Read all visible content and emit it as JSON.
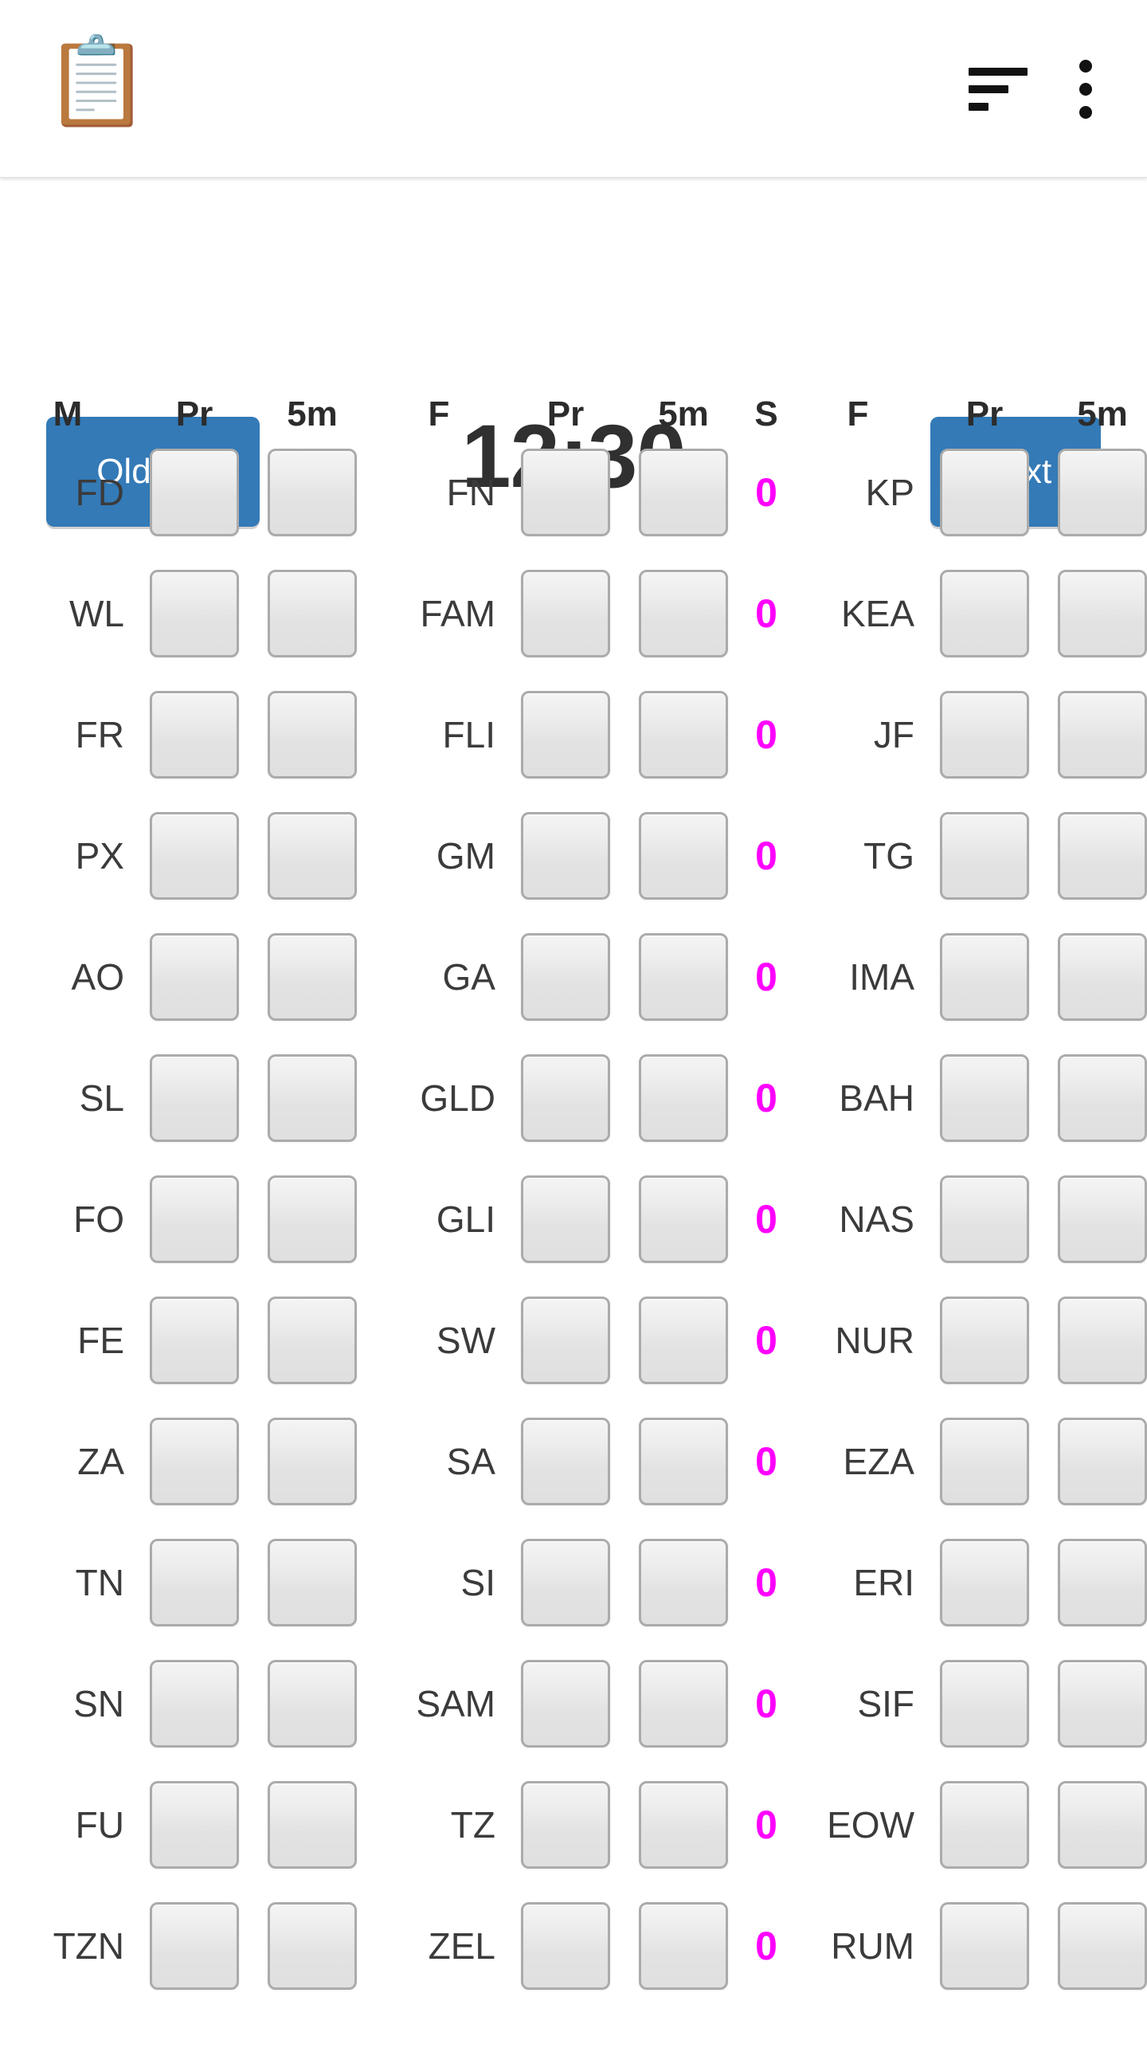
{
  "appbar": {
    "logo_icon": "clipboard-chart-icon",
    "logo_glyph": "📋",
    "sort_icon": "sort-filter-icon",
    "overflow_icon": "overflow-menu-icon"
  },
  "toolbar": {
    "older_label": "Older",
    "older_caret": "▾",
    "clock": "12:30",
    "next_label": "Next"
  },
  "colors": {
    "primary_blue": "#337ab7",
    "score_magenta": "#FF00FF",
    "text_dark": "#2e2e2e",
    "input_border": "#ababab",
    "input_fill": "#e4e4e4"
  },
  "grid": {
    "headers": [
      "M",
      "Pr",
      "5m",
      "F",
      "Pr",
      "5m",
      "S",
      "F",
      "Pr",
      "5m"
    ],
    "input_placeholder": "",
    "rows": [
      {
        "m": "FD",
        "m_pr": "",
        "m_5m": "",
        "f": "FN",
        "f_pr": "",
        "f_5m": "",
        "s": "0",
        "f2": "KP",
        "f2_pr": "",
        "f2_5m": ""
      },
      {
        "m": "WL",
        "m_pr": "",
        "m_5m": "",
        "f": "FAM",
        "f_pr": "",
        "f_5m": "",
        "s": "0",
        "f2": "KEA",
        "f2_pr": "",
        "f2_5m": ""
      },
      {
        "m": "FR",
        "m_pr": "",
        "m_5m": "",
        "f": "FLI",
        "f_pr": "",
        "f_5m": "",
        "s": "0",
        "f2": "JF",
        "f2_pr": "",
        "f2_5m": ""
      },
      {
        "m": "PX",
        "m_pr": "",
        "m_5m": "",
        "f": "GM",
        "f_pr": "",
        "f_5m": "",
        "s": "0",
        "f2": "TG",
        "f2_pr": "",
        "f2_5m": ""
      },
      {
        "m": "AO",
        "m_pr": "",
        "m_5m": "",
        "f": "GA",
        "f_pr": "",
        "f_5m": "",
        "s": "0",
        "f2": "IMA",
        "f2_pr": "",
        "f2_5m": ""
      },
      {
        "m": "SL",
        "m_pr": "",
        "m_5m": "",
        "f": "GLD",
        "f_pr": "",
        "f_5m": "",
        "s": "0",
        "f2": "BAH",
        "f2_pr": "",
        "f2_5m": ""
      },
      {
        "m": "FO",
        "m_pr": "",
        "m_5m": "",
        "f": "GLI",
        "f_pr": "",
        "f_5m": "",
        "s": "0",
        "f2": "NAS",
        "f2_pr": "",
        "f2_5m": ""
      },
      {
        "m": "FE",
        "m_pr": "",
        "m_5m": "",
        "f": "SW",
        "f_pr": "",
        "f_5m": "",
        "s": "0",
        "f2": "NUR",
        "f2_pr": "",
        "f2_5m": ""
      },
      {
        "m": "ZA",
        "m_pr": "",
        "m_5m": "",
        "f": "SA",
        "f_pr": "",
        "f_5m": "",
        "s": "0",
        "f2": "EZA",
        "f2_pr": "",
        "f2_5m": ""
      },
      {
        "m": "TN",
        "m_pr": "",
        "m_5m": "",
        "f": "SI",
        "f_pr": "",
        "f_5m": "",
        "s": "0",
        "f2": "ERI",
        "f2_pr": "",
        "f2_5m": ""
      },
      {
        "m": "SN",
        "m_pr": "",
        "m_5m": "",
        "f": "SAM",
        "f_pr": "",
        "f_5m": "",
        "s": "0",
        "f2": "SIF",
        "f2_pr": "",
        "f2_5m": ""
      },
      {
        "m": "FU",
        "m_pr": "",
        "m_5m": "",
        "f": "TZ",
        "f_pr": "",
        "f_5m": "",
        "s": "0",
        "f2": "EOW",
        "f2_pr": "",
        "f2_5m": ""
      },
      {
        "m": "TZN",
        "m_pr": "",
        "m_5m": "",
        "f": "ZEL",
        "f_pr": "",
        "f_5m": "",
        "s": "0",
        "f2": "RUM",
        "f2_pr": "",
        "f2_5m": ""
      }
    ]
  }
}
